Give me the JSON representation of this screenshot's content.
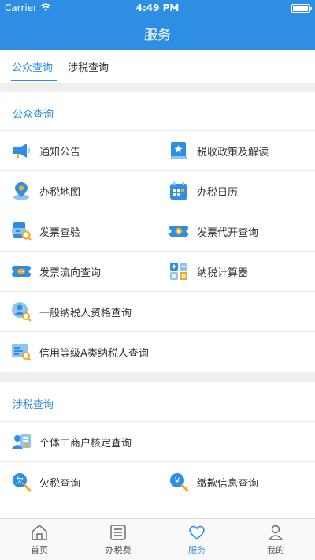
{
  "status_bar": {
    "carrier": "Carrier",
    "time": "4:49 PM"
  },
  "header": {
    "title": "服务"
  },
  "tabs": [
    {
      "label": "公众查询",
      "active": true
    },
    {
      "label": "涉税查询",
      "active": false
    }
  ],
  "sections": {
    "public": {
      "title": "公众查询",
      "items": [
        {
          "label": "通知公告",
          "icon": "megaphone-icon"
        },
        {
          "label": "税收政策及解读",
          "icon": "policy-book-icon"
        },
        {
          "label": "办税地图",
          "icon": "map-pin-icon"
        },
        {
          "label": "办税日历",
          "icon": "calendar-icon"
        },
        {
          "label": "发票查验",
          "icon": "invoice-check-icon"
        },
        {
          "label": "发票代开查询",
          "icon": "invoice-issue-icon"
        },
        {
          "label": "发票流向查询",
          "icon": "invoice-flow-icon"
        },
        {
          "label": "纳税计算器",
          "icon": "calculator-icon"
        },
        {
          "label": "一般纳税人资格查询",
          "icon": "taxpayer-search-icon"
        },
        {
          "label": "信用等级A类纳税人查询",
          "icon": "credit-search-icon"
        }
      ]
    },
    "tax": {
      "title": "涉税查询",
      "items": [
        {
          "label": "个体工商户核定查询",
          "icon": "business-card-icon"
        },
        {
          "label": "欠税查询",
          "icon": "arrears-search-icon",
          "badge": "欠"
        },
        {
          "label": "缴款信息查询",
          "icon": "payment-search-icon",
          "badge": "￥"
        }
      ]
    }
  },
  "tabbar": [
    {
      "label": "首页",
      "icon": "home-icon",
      "active": false
    },
    {
      "label": "办税费",
      "icon": "list-icon",
      "active": false
    },
    {
      "label": "服务",
      "icon": "heart-icon",
      "active": true
    },
    {
      "label": "我的",
      "icon": "person-icon",
      "active": false
    }
  ],
  "colors": {
    "accent": "#2d8ee3",
    "icon_orange": "#f5a623",
    "icon_light_blue": "#8fc4ef"
  }
}
